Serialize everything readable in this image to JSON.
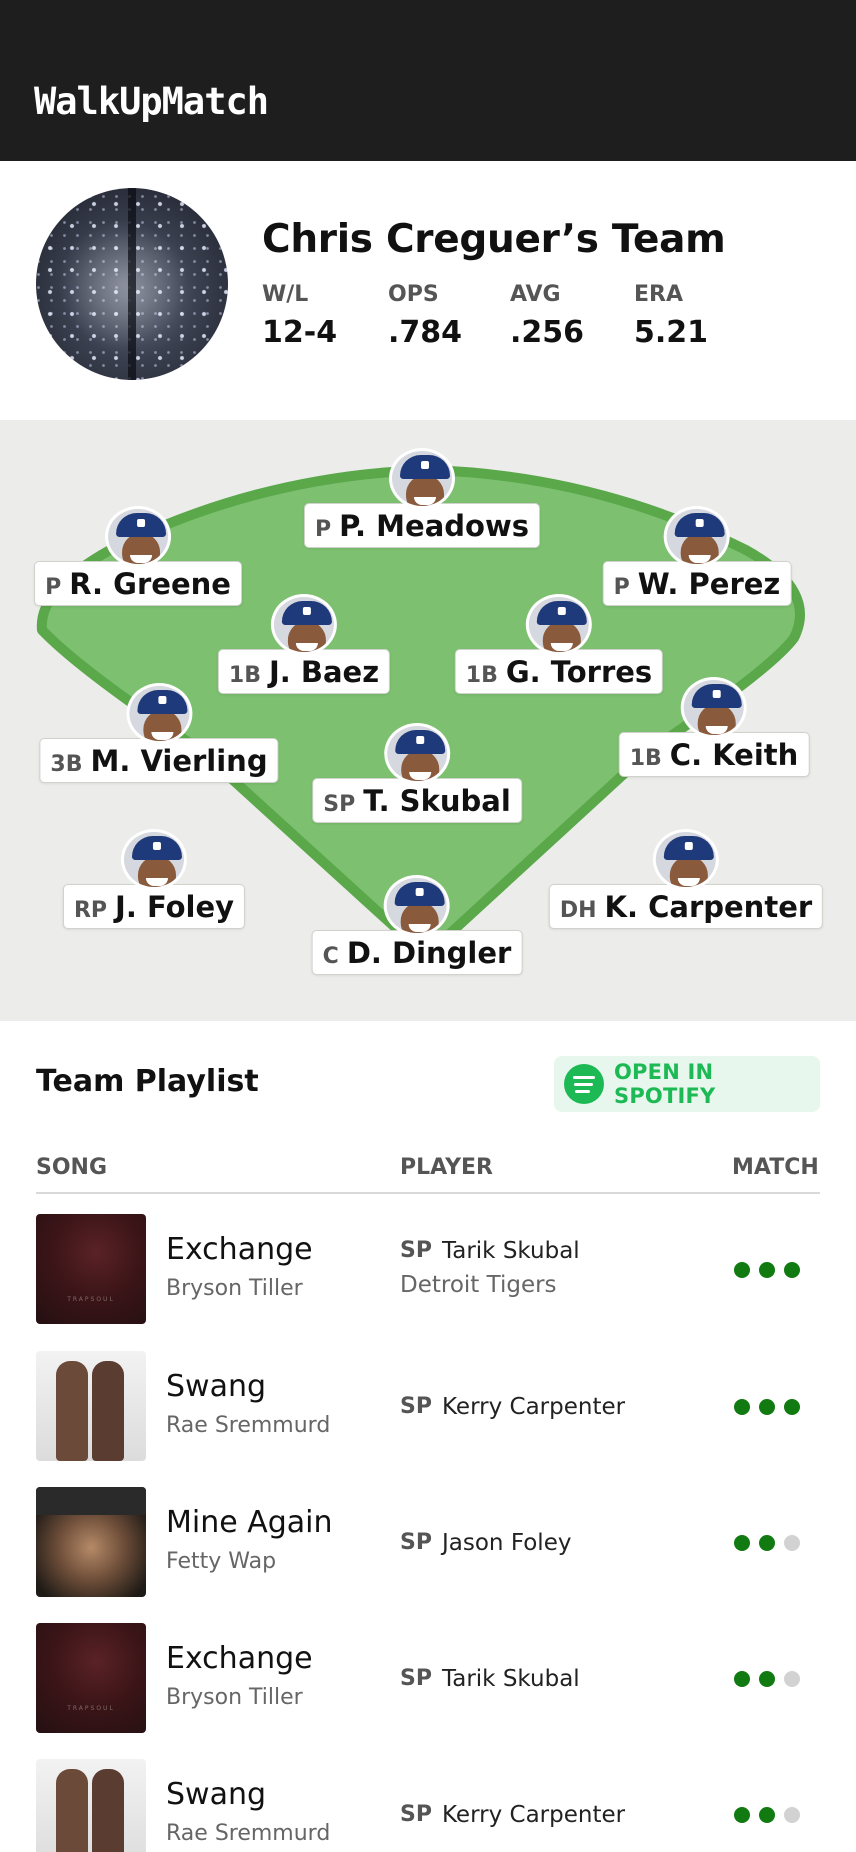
{
  "app": {
    "title": "WalkUpMatch"
  },
  "team": {
    "name": "Chris Creguer’s Team",
    "stats": [
      {
        "label": "W/L",
        "value": "12-4"
      },
      {
        "label": "OPS",
        "value": ".784"
      },
      {
        "label": "AVG",
        "value": ".256"
      },
      {
        "label": "ERA",
        "value": "5.21"
      }
    ]
  },
  "field": {
    "players": [
      {
        "pos": "P",
        "name": "P. Meadows"
      },
      {
        "pos": "P",
        "name": "R. Greene"
      },
      {
        "pos": "P",
        "name": "W. Perez"
      },
      {
        "pos": "1B",
        "name": "J. Baez"
      },
      {
        "pos": "1B",
        "name": "G. Torres"
      },
      {
        "pos": "3B",
        "name": "M. Vierling"
      },
      {
        "pos": "1B",
        "name": "C. Keith"
      },
      {
        "pos": "SP",
        "name": "T. Skubal"
      },
      {
        "pos": "RP",
        "name": "J. Foley"
      },
      {
        "pos": "DH",
        "name": "K. Carpenter"
      },
      {
        "pos": "C",
        "name": "D. Dingler"
      }
    ]
  },
  "playlist": {
    "title": "Team Playlist",
    "spotify_label": "OPEN IN SPOTIFY",
    "columns": {
      "song": "SONG",
      "player": "PLAYER",
      "match": "MATCH"
    },
    "rows": [
      {
        "title": "Exchange",
        "artist": "Bryson Tiller",
        "pos": "SP",
        "player": "Tarik Skubal",
        "team": "Detroit Tigers",
        "match": 3,
        "art": "trapsoul"
      },
      {
        "title": "Swang",
        "artist": "Rae Sremmurd",
        "pos": "SP",
        "player": "Kerry Carpenter",
        "team": "",
        "match": 3,
        "art": "swang"
      },
      {
        "title": "Mine Again",
        "artist": "Fetty Wap",
        "pos": "SP",
        "player": "Jason Foley",
        "team": "",
        "match": 2,
        "art": "fetty"
      },
      {
        "title": "Exchange",
        "artist": "Bryson Tiller",
        "pos": "SP",
        "player": "Tarik Skubal",
        "team": "",
        "match": 2,
        "art": "trapsoul"
      },
      {
        "title": "Swang",
        "artist": "Rae Sremmurd",
        "pos": "SP",
        "player": "Kerry Carpenter",
        "team": "",
        "match": 2,
        "art": "swang"
      }
    ]
  },
  "colors": {
    "header_bg": "#1e1e1e",
    "field_grass": "#7cc070",
    "field_border": "#5aa84a",
    "spotify_green": "#1db954",
    "match_on": "#117a11",
    "match_off": "#d2d2d2"
  }
}
